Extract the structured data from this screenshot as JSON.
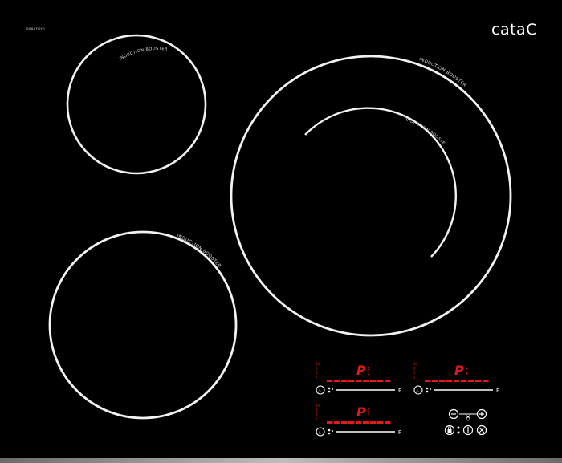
{
  "brand": {
    "logo_text": "cata",
    "model_code": "B899DRID"
  },
  "zones": [
    {
      "id": "small",
      "label": "INDUCTION BOOSTER"
    },
    {
      "id": "large",
      "label": "INDUCTION BOOSTER",
      "inner_label": "INDUCTION BOOSTER"
    },
    {
      "id": "medium",
      "label": "INDUCTION BOOSTER"
    }
  ],
  "controls": {
    "panels": [
      {
        "id": "zone-front-left",
        "display": "P",
        "power_label": "P",
        "level_marks": [
          "10",
          "8",
          "5",
          "1"
        ]
      },
      {
        "id": "zone-front-right",
        "display": "P",
        "power_label": "P",
        "level_marks": [
          "10",
          "8",
          "5",
          "1"
        ]
      },
      {
        "id": "zone-rear-left",
        "display": "P",
        "power_label": "P",
        "level_marks": [
          "10",
          "8",
          "5",
          "1"
        ]
      }
    ],
    "timer": {
      "minus_icon": "minus-icon",
      "plus_icon": "plus-icon"
    },
    "icons": [
      "lock-icon",
      "zone-select-icon",
      "power-icon",
      "pause-icon"
    ]
  },
  "colors": {
    "glass": "#000000",
    "ring": "#f2f2f2",
    "control_red": "#e11a1a",
    "control_white": "#ffffff",
    "frame": "#9a9a9a"
  }
}
